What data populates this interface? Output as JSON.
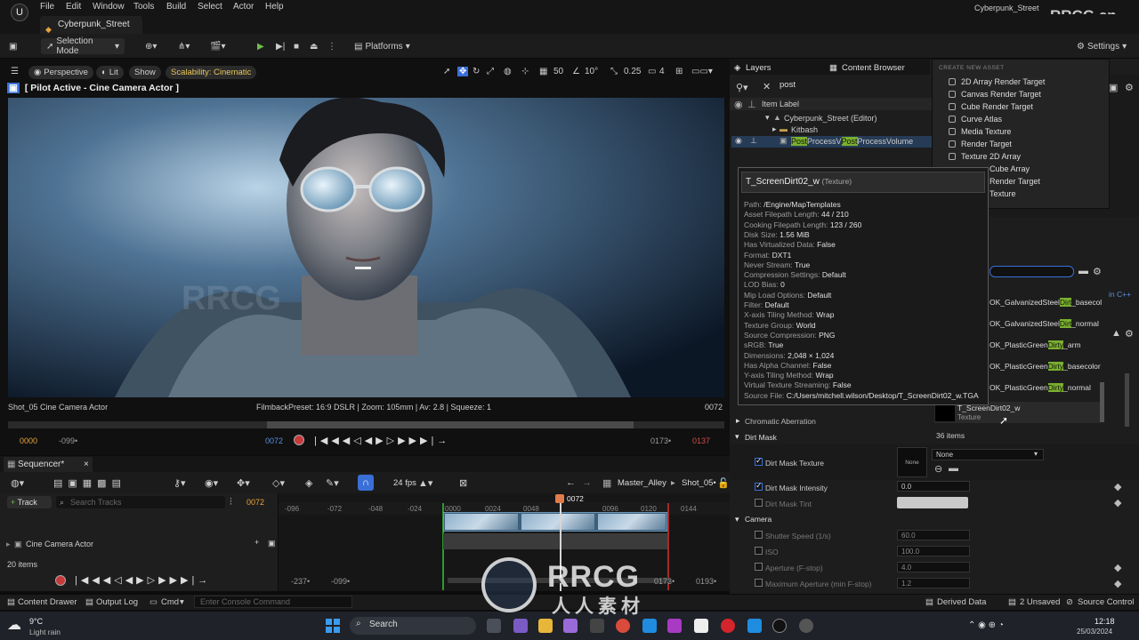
{
  "menu": {
    "items": [
      "File",
      "Edit",
      "Window",
      "Tools",
      "Build",
      "Select",
      "Actor",
      "Help"
    ],
    "project_name": "Cyberpunk_Street",
    "watermark_top": "RRCG.cn"
  },
  "doc_tab": {
    "label": "Cyberpunk_Street"
  },
  "toolbar": {
    "selection_mode": "Selection Mode",
    "platforms": "Platforms",
    "settings": "Settings"
  },
  "viewport": {
    "perspective": "Perspective",
    "lit": "Lit",
    "show": "Show",
    "scalability": "Scalability: Cinematic",
    "pilot_label": "[ Pilot Active - Cine Camera Actor ]",
    "grid_snap": "50",
    "rot_snap": "10°",
    "scale_snap": "0.25",
    "cam_speed": "4",
    "camera_name": "Shot_05 Cine Camera Actor",
    "filmback": "FilmbackPreset: 16:9 DSLR | Zoom: 105mm | Av: 2.8 | Squeeze: 1",
    "frame_right": "0072",
    "transport": {
      "start": "0000",
      "start_neg": "-099•",
      "current": "0072",
      "end": "0173•",
      "end2": "0137"
    }
  },
  "sequencer": {
    "tab": "Sequencer*",
    "fps": "24 fps",
    "breadcrumb_master": "Master_Alley",
    "breadcrumb_shot": "Shot_05•",
    "add_track": "Track",
    "search_placeholder": "Search Tracks",
    "frame": "0072",
    "playhead_label": "0072",
    "ruler_ticks": [
      "-096",
      "-072",
      "-048",
      "-024",
      "0000",
      "0024",
      "0048",
      "0096",
      "0120",
      "0144"
    ],
    "track_name": "Cine Camera Actor",
    "item_count": "20 items",
    "bottom": {
      "left": "-237•",
      "left2": "-099•",
      "right": "0173•",
      "right2": "0193•"
    }
  },
  "statusbar": {
    "content_drawer": "Content Drawer",
    "output_log": "Output Log",
    "cmd": "Cmd",
    "console_placeholder": "Enter Console Command",
    "derived_data": "Derived Data",
    "unsaved": "2 Unsaved",
    "source_control": "Source Control"
  },
  "taskbar": {
    "weather_temp": "9°C",
    "weather_desc": "Light rain",
    "search": "Search",
    "time": "12:18",
    "date": "25/03/2024"
  },
  "right_panel": {
    "tab_layers": "Layers",
    "tab_content_browser": "Content Browser",
    "outliner_search": "post",
    "column_item_label": "Item Label",
    "rows": [
      {
        "label": "Cyberpunk_Street (Editor)"
      },
      {
        "label": "Kitbash"
      },
      {
        "label_pre": "",
        "hl1": "Post",
        "mid": "ProcessV",
        "hl2": "Post",
        "label_post": "ProcessVolume"
      }
    ]
  },
  "create_asset_menu": {
    "header": "CREATE NEW ASSET",
    "items": [
      "2D Array Render Target",
      "Canvas Render Target",
      "Cube Render Target",
      "Curve Atlas",
      "Media Texture",
      "Render Target",
      "Texture 2D Array",
      "Cube Array",
      "Render Target",
      "Texture"
    ]
  },
  "tooltip": {
    "title": "T_ScreenDirt02_w",
    "type": "(Texture)",
    "lines": [
      {
        "k": "Path:",
        "v": "/Engine/MapTemplates"
      },
      {
        "k": "Asset Filepath Length:",
        "v": "44 / 210"
      },
      {
        "k": "Cooking Filepath Length:",
        "v": "123 / 260"
      },
      {
        "k": "Disk Size:",
        "v": "1.56 MiB"
      },
      {
        "k": "Has Virtualized Data:",
        "v": "False"
      },
      {
        "k": "Format:",
        "v": "DXT1"
      },
      {
        "k": "Never Stream:",
        "v": "True"
      },
      {
        "k": "Compression Settings:",
        "v": "Default"
      },
      {
        "k": "LOD Bias:",
        "v": "0"
      },
      {
        "k": "Mip Load Options:",
        "v": "Default"
      },
      {
        "k": "Filter:",
        "v": "Default"
      },
      {
        "k": "X-axis Tiling Method:",
        "v": "Wrap"
      },
      {
        "k": "Texture Group:",
        "v": "World"
      },
      {
        "k": "Source Compression:",
        "v": "PNG"
      },
      {
        "k": "sRGB:",
        "v": "True"
      },
      {
        "k": "Dimensions:",
        "v": "2,048 × 1,024"
      },
      {
        "k": "Has Alpha Channel:",
        "v": "False"
      },
      {
        "k": "Y-axis Tiling Method:",
        "v": "Wrap"
      },
      {
        "k": "Virtual Texture Streaming:",
        "v": "False"
      },
      {
        "k": "Source File:",
        "v": "C:/Users/mitchell.wilson/Desktop/T_ScreenDirt02_w.TGA"
      }
    ]
  },
  "asset_list": {
    "items": [
      {
        "pre": "OK_GalvanizedSteel",
        "hl": "Dirt",
        "post": "_basecol"
      },
      {
        "pre": "OK_GalvanizedSteel",
        "hl": "Dirt",
        "post": "_normal"
      },
      {
        "pre": "OK_PlasticGreen",
        "hl": "Dirty",
        "post": "_arm"
      },
      {
        "pre": "OK_PlasticGreen",
        "hl": "Dirty",
        "post": "_basecolor"
      },
      {
        "pre": "OK_PlasticGreen",
        "hl": "Dirty",
        "post": "_normal"
      }
    ],
    "selected_name": "T_ScreenDirt02_w",
    "selected_type": "Texture",
    "count": "36 items",
    "in_cpp": "in C++"
  },
  "details": {
    "chromatic_aberration": "Chromatic Aberration",
    "dirt_mask": "Dirt Mask",
    "dirt_mask_texture": "Dirt Mask Texture",
    "texture_value": "None",
    "texture_thumb": "None",
    "dirt_mask_intensity": "Dirt Mask Intensity",
    "intensity_value": "0.0",
    "dirt_mask_tint": "Dirt Mask Tint",
    "camera": "Camera",
    "shutter_speed": "Shutter Speed (1/s)",
    "shutter_value": "60.0",
    "iso": "ISO",
    "iso_value": "100.0",
    "aperture": "Aperture (F-stop)",
    "aperture_value": "4.0",
    "max_aperture": "Maximum Aperture (min F-stop)",
    "max_aperture_value": "1.2"
  },
  "watermark": {
    "logo": "RRCG",
    "sub": "人人素材"
  }
}
